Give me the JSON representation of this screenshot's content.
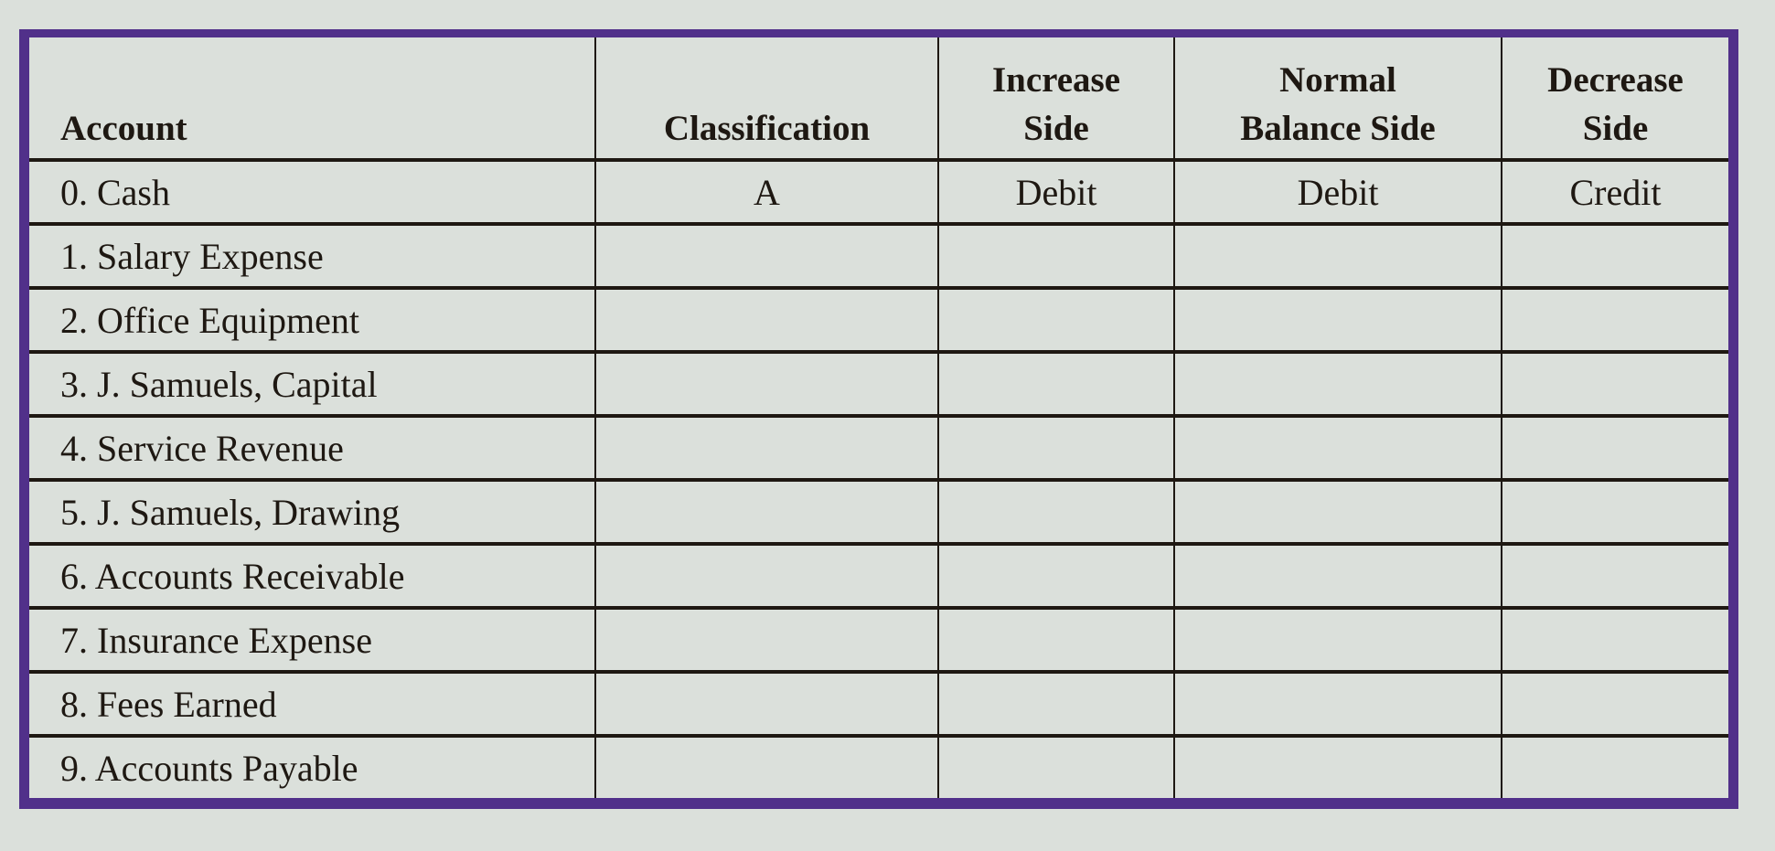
{
  "table": {
    "headers": {
      "account": "Account",
      "classification": "Classification",
      "increase_side": [
        "Increase",
        "Side"
      ],
      "normal_balance_side": [
        "Normal",
        "Balance Side"
      ],
      "decrease_side": [
        "Decrease",
        "Side"
      ]
    },
    "rows": [
      {
        "account": "0. Cash",
        "classification": "A",
        "increase": "Debit",
        "normal": "Debit",
        "decrease": "Credit"
      },
      {
        "account": "1. Salary Expense",
        "classification": "",
        "increase": "",
        "normal": "",
        "decrease": ""
      },
      {
        "account": "2. Office Equipment",
        "classification": "",
        "increase": "",
        "normal": "",
        "decrease": ""
      },
      {
        "account": "3. J. Samuels, Capital",
        "classification": "",
        "increase": "",
        "normal": "",
        "decrease": ""
      },
      {
        "account": "4. Service Revenue",
        "classification": "",
        "increase": "",
        "normal": "",
        "decrease": ""
      },
      {
        "account": "5. J. Samuels, Drawing",
        "classification": "",
        "increase": "",
        "normal": "",
        "decrease": ""
      },
      {
        "account": "6. Accounts Receivable",
        "classification": "",
        "increase": "",
        "normal": "",
        "decrease": ""
      },
      {
        "account": "7. Insurance Expense",
        "classification": "",
        "increase": "",
        "normal": "",
        "decrease": ""
      },
      {
        "account": "8. Fees Earned",
        "classification": "",
        "increase": "",
        "normal": "",
        "decrease": ""
      },
      {
        "account": "9. Accounts Payable",
        "classification": "",
        "increase": "",
        "normal": "",
        "decrease": ""
      }
    ]
  },
  "colors": {
    "frame": "#51308a",
    "background": "#dbe0db",
    "rule": "#1e1812"
  }
}
